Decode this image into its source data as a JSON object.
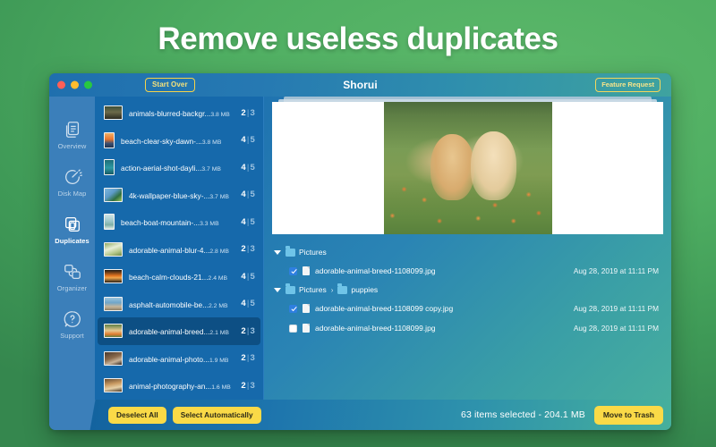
{
  "headline": "Remove useless duplicates",
  "window": {
    "title": "Shorui",
    "start_over_label": "Start Over",
    "feature_request_label": "Feature Request",
    "traffic_lights": [
      "close-red",
      "minimize-yellow",
      "maximize-green"
    ]
  },
  "sidebar": {
    "items": [
      {
        "label": "Overview",
        "icon": "documents-stack-icon",
        "active": false
      },
      {
        "label": "Disk Map",
        "icon": "pie-chart-icon",
        "active": false
      },
      {
        "label": "Duplicates",
        "icon": "copy-squares-icon",
        "active": true
      },
      {
        "label": "Organizer",
        "icon": "folders-link-icon",
        "active": false
      },
      {
        "label": "Support",
        "icon": "question-bubble-icon",
        "active": false
      }
    ]
  },
  "duplicates_list": [
    {
      "name": "animals-blurred-backgr...",
      "size": "3.8 MB",
      "selected_count": "2",
      "total_count": "3",
      "thumb": "landscape-night",
      "orientation": "landscape",
      "active": false
    },
    {
      "name": "beach-clear-sky-dawn-...",
      "size": "3.8 MB",
      "selected_count": "4",
      "total_count": "5",
      "thumb": "sunset-beach",
      "orientation": "portrait",
      "active": false
    },
    {
      "name": "action-aerial-shot-dayli...",
      "size": "3.7 MB",
      "selected_count": "4",
      "total_count": "5",
      "thumb": "teal-water",
      "orientation": "portrait",
      "active": false
    },
    {
      "name": "4k-wallpaper-blue-sky-...",
      "size": "3.7 MB",
      "selected_count": "4",
      "total_count": "5",
      "thumb": "blue-sky-leaves",
      "orientation": "landscape",
      "active": false
    },
    {
      "name": "beach-boat-mountain-...",
      "size": "3.3 MB",
      "selected_count": "4",
      "total_count": "5",
      "thumb": "pale-beach",
      "orientation": "portrait",
      "active": false
    },
    {
      "name": "adorable-animal-blur-4...",
      "size": "2.8 MB",
      "selected_count": "2",
      "total_count": "3",
      "thumb": "white-flowers",
      "orientation": "landscape",
      "active": false
    },
    {
      "name": "beach-calm-clouds-21...",
      "size": "2.4 MB",
      "selected_count": "4",
      "total_count": "5",
      "thumb": "orange-sunset",
      "orientation": "landscape",
      "active": false
    },
    {
      "name": "asphalt-automobile-be...",
      "size": "2.2 MB",
      "selected_count": "4",
      "total_count": "5",
      "thumb": "road-coast",
      "orientation": "landscape",
      "active": false
    },
    {
      "name": "adorable-animal-breed...",
      "size": "2.1 MB",
      "selected_count": "2",
      "total_count": "3",
      "thumb": "puppies-grass",
      "orientation": "landscape",
      "active": true
    },
    {
      "name": "adorable-animal-photo...",
      "size": "1.9 MB",
      "selected_count": "2",
      "total_count": "3",
      "thumb": "dog-dark",
      "orientation": "landscape",
      "active": false
    },
    {
      "name": "animal-photography-an...",
      "size": "1.6 MB",
      "selected_count": "2",
      "total_count": "3",
      "thumb": "dog-portrait",
      "orientation": "landscape",
      "active": false
    }
  ],
  "preview": {
    "alt": "two golden retriever puppies sitting in grass with orange flowers",
    "stacked_sheets": 2
  },
  "file_tree": [
    {
      "path_crumbs": [
        "Pictures"
      ],
      "expanded": true,
      "files": [
        {
          "name": "adorable-animal-breed-1108099.jpg",
          "date": "Aug 28, 2019 at 11:11 PM",
          "checked": true
        }
      ]
    },
    {
      "path_crumbs": [
        "Pictures",
        "puppies"
      ],
      "expanded": true,
      "files": [
        {
          "name": "adorable-animal-breed-1108099 copy.jpg",
          "date": "Aug 28, 2019 at 11:11 PM",
          "checked": true
        },
        {
          "name": "adorable-animal-breed-1108099.jpg",
          "date": "Aug 28, 2019 at 11:11 PM",
          "checked": false
        }
      ]
    }
  ],
  "bottom_bar": {
    "deselect_all_label": "Deselect All",
    "select_automatically_label": "Select Automatically",
    "status": "63 items selected - 204.1 MB",
    "move_to_trash_label": "Move to Trash"
  },
  "colors": {
    "background_green": "#4fae62",
    "window_blue": "#1669ab",
    "sidebar_blue": "#3b7fba",
    "accent_yellow": "#fada47",
    "teal": "#47ae9e",
    "selection_blue": "#0d4f84"
  }
}
